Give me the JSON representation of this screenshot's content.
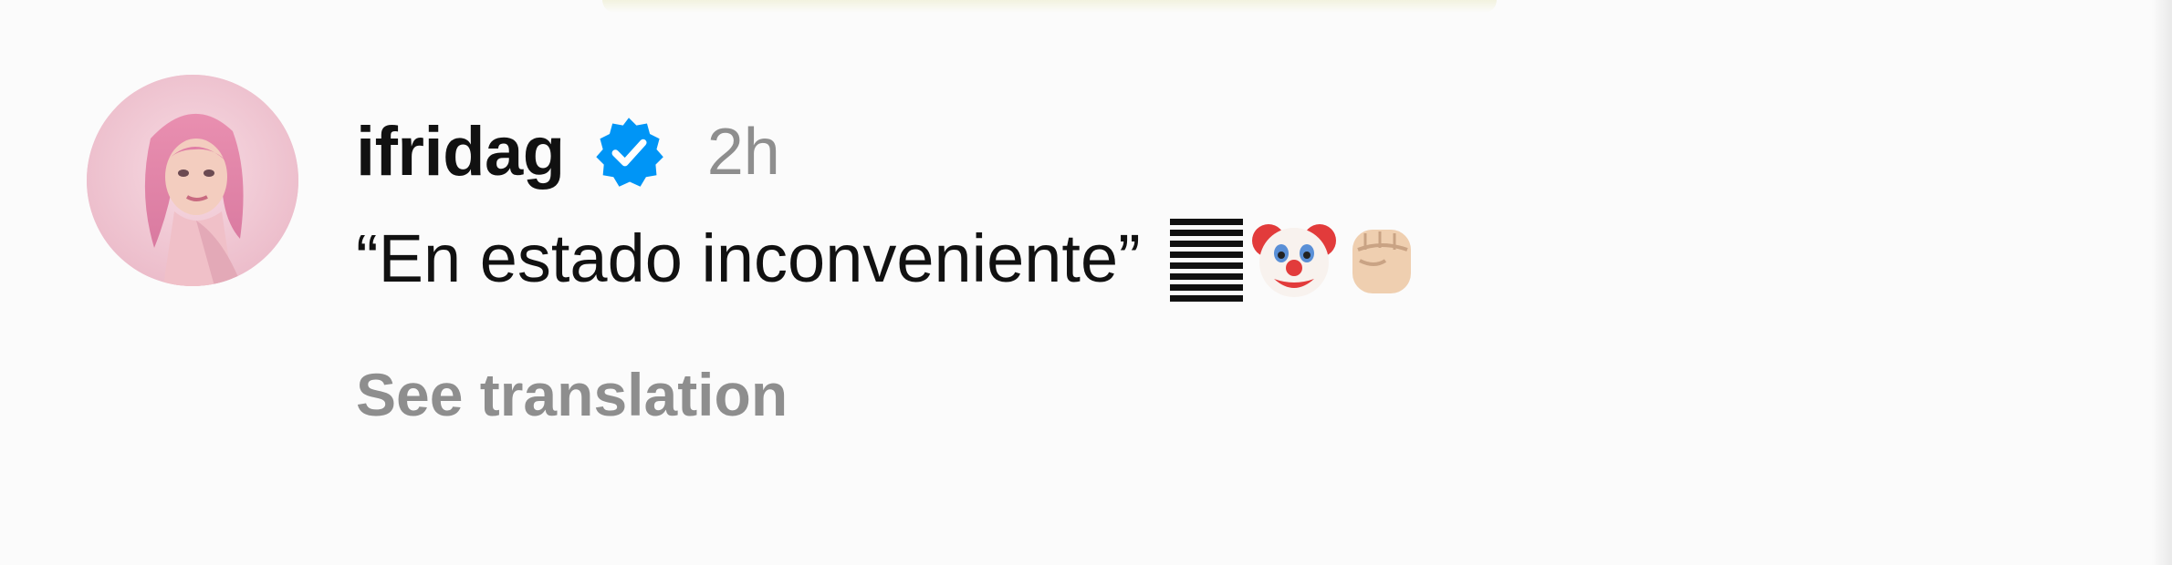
{
  "comment": {
    "username": "ifridag",
    "verified_icon": "verified-badge-icon",
    "timestamp": "2h",
    "text": "“En estado inconveniente”",
    "emojis": [
      "wavy-lines-icon",
      "clown-face-icon",
      "raised-fist-icon"
    ],
    "see_translation_label": "See translation"
  },
  "colors": {
    "username": "#111111",
    "muted": "#8e8e8e",
    "verified_blue": "#0095f6",
    "background": "#fbfbfb"
  }
}
